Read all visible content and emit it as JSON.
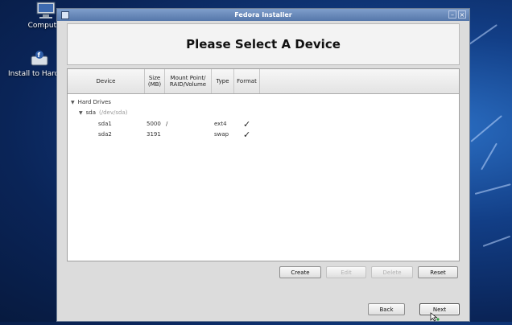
{
  "desktop": {
    "icons": [
      {
        "label": "Computer",
        "icon": "computer-icon"
      },
      {
        "label": "Install to Hard Drive",
        "icon": "install-icon"
      }
    ]
  },
  "window": {
    "title": "Fedora Installer",
    "controls": [
      "minimize",
      "close"
    ]
  },
  "banner": {
    "heading": "Please Select A Device"
  },
  "table": {
    "headers": {
      "device": "Device",
      "size": "Size\n(MB)",
      "mount": "Mount Point/\nRAID/Volume",
      "type": "Type",
      "format": "Format"
    },
    "group": "Hard Drives",
    "drive": {
      "name": "sda",
      "desc": "(/dev/sda)"
    },
    "partitions": [
      {
        "device": "sda1",
        "size": "5000",
        "mount": "/",
        "type": "ext4",
        "format": "✓"
      },
      {
        "device": "sda2",
        "size": "3191",
        "mount": "",
        "type": "swap",
        "format": "✓"
      }
    ]
  },
  "actions": {
    "create": "Create",
    "edit": "Edit",
    "delete": "Delete",
    "reset": "Reset"
  },
  "nav": {
    "back": "Back",
    "next": "Next"
  }
}
